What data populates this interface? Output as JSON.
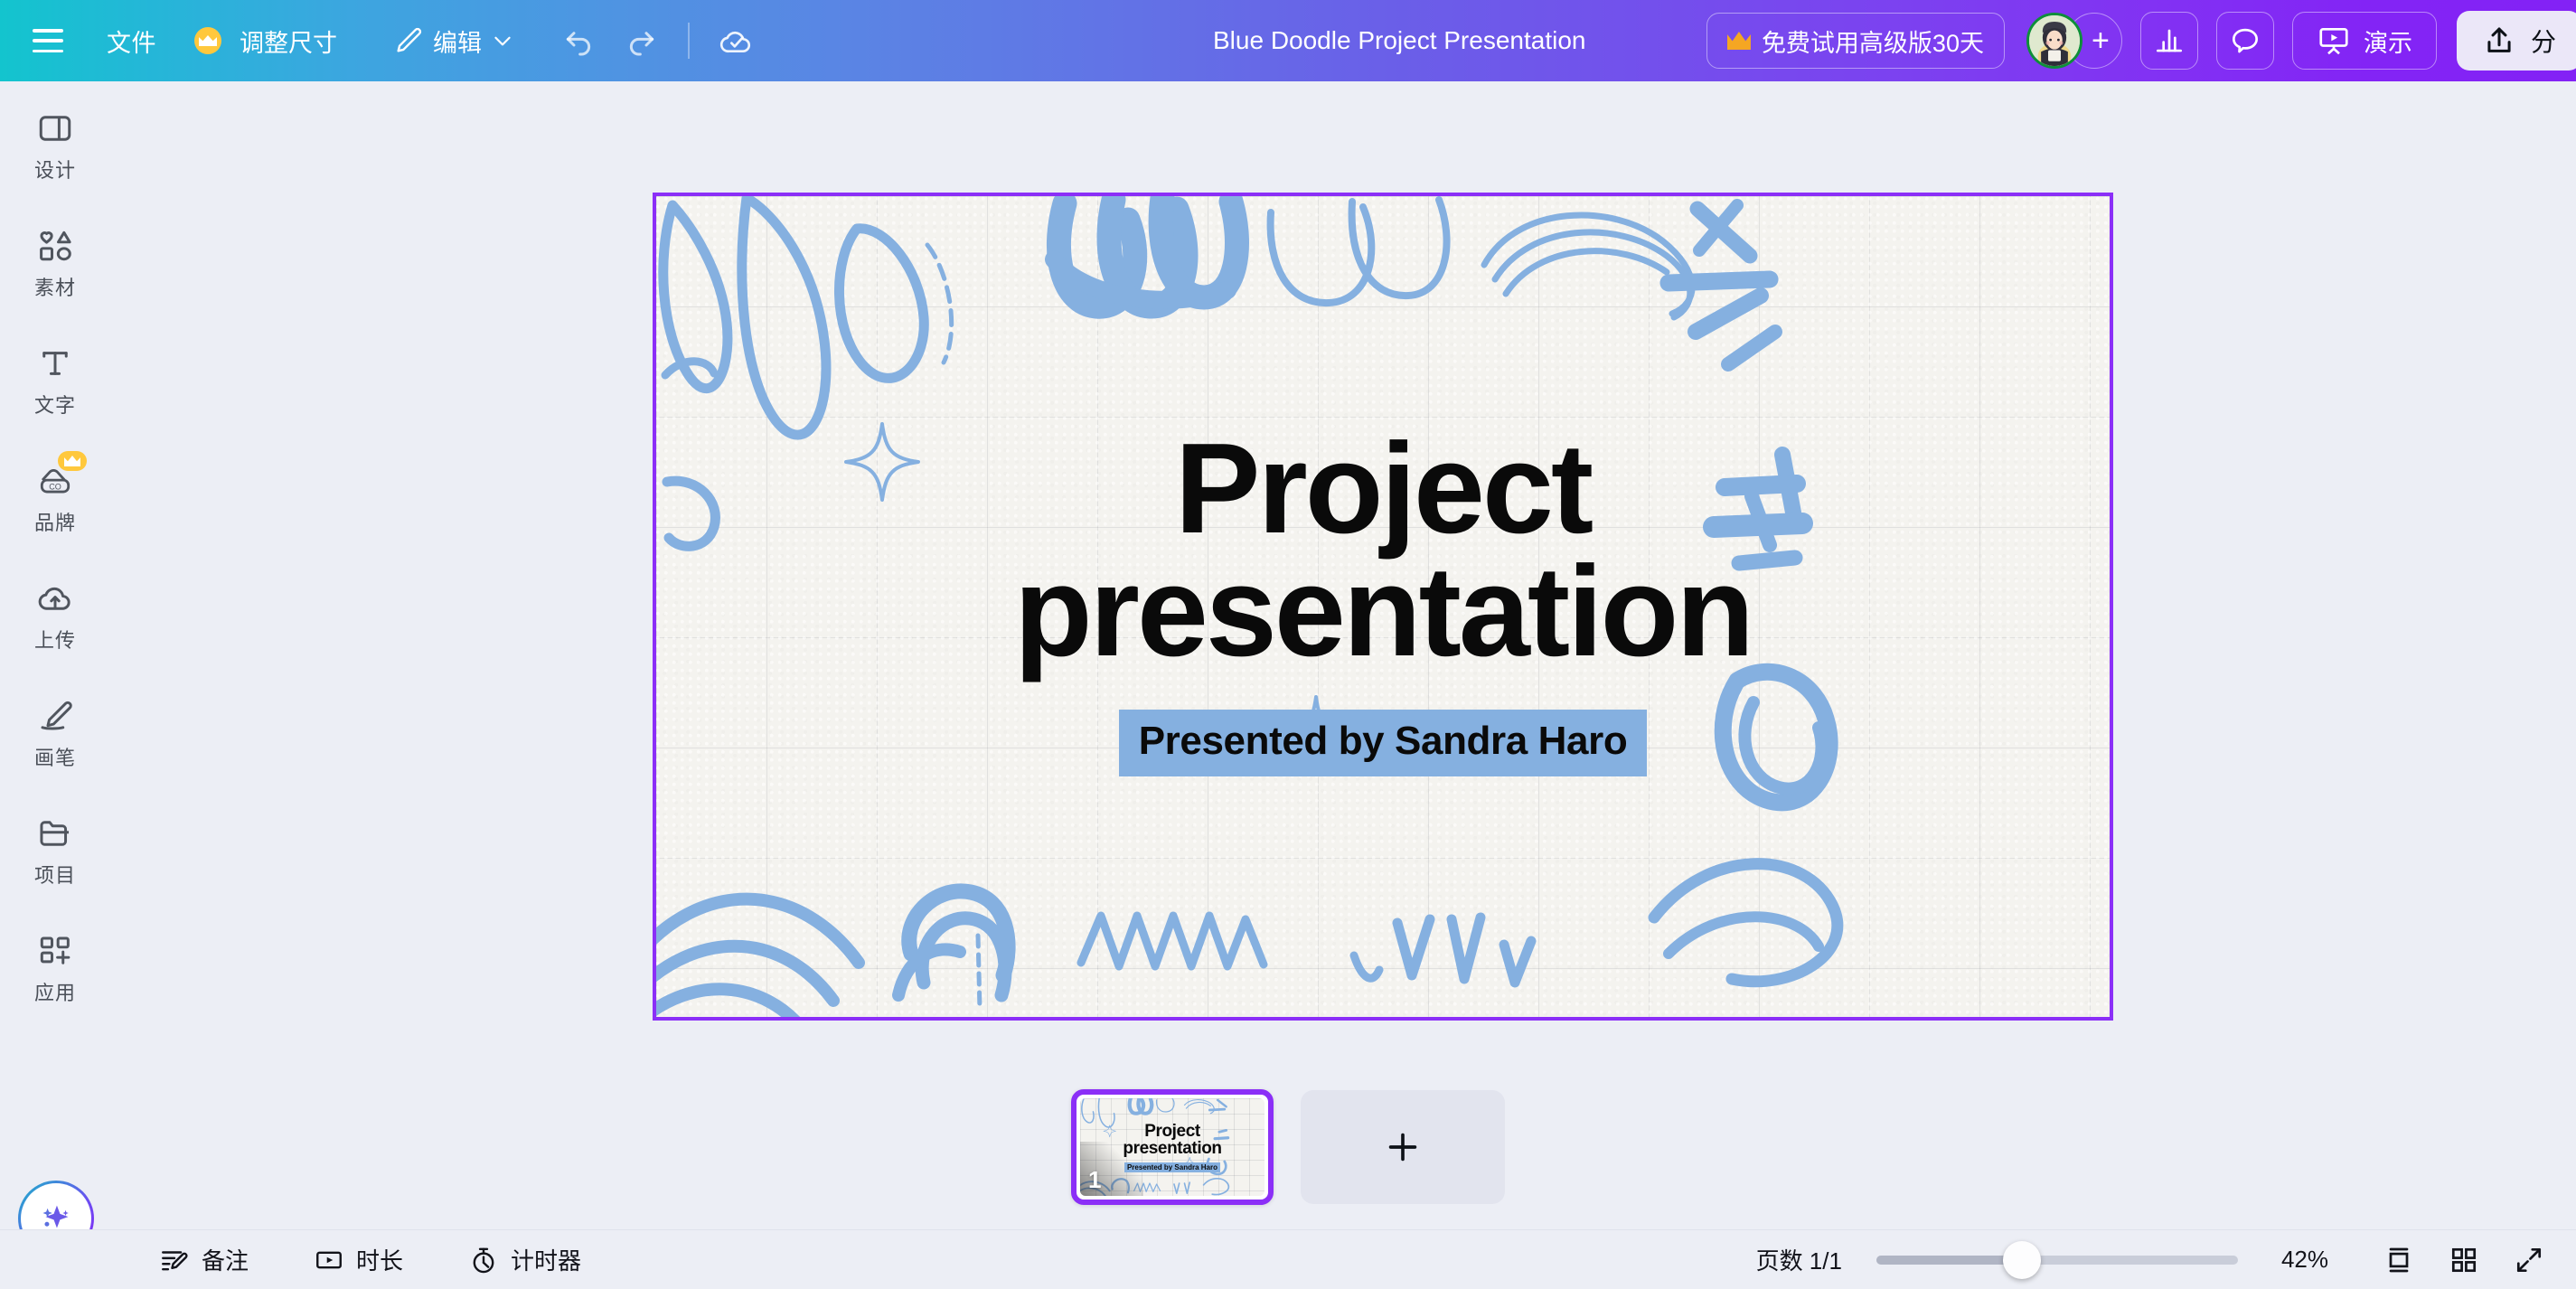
{
  "topbar": {
    "menu_icon": "hamburger-menu-icon",
    "file_label": "文件",
    "resize_label": "调整尺寸",
    "resize_icon": "crown-badge-icon",
    "edit_label": "编辑",
    "edit_icon": "pencil-icon",
    "edit_chevron": "chevron-down-icon",
    "undo_icon": "undo-arrow-icon",
    "redo_icon": "redo-arrow-icon",
    "saved_icon": "cloud-check-icon",
    "doc_title": "Blue Doodle Project Presentation",
    "trial_label": "免费试用高级版30天",
    "trial_icon": "crown-icon",
    "avatar_name": "user-avatar",
    "add_collaborator": "+",
    "insights_icon": "bar-chart-icon",
    "comments_icon": "speech-bubble-icon",
    "present_label": "演示",
    "present_icon": "presentation-play-icon",
    "share_label": "分",
    "share_icon": "share-upload-icon"
  },
  "sidebar": {
    "items": [
      {
        "label": "设计",
        "icon": "layout-panel-icon",
        "badge": false
      },
      {
        "label": "素材",
        "icon": "shapes-elements-icon",
        "badge": false
      },
      {
        "label": "文字",
        "icon": "text-t-icon",
        "badge": false
      },
      {
        "label": "品牌",
        "icon": "brand-kit-icon",
        "badge": true
      },
      {
        "label": "上传",
        "icon": "cloud-upload-icon",
        "badge": false
      },
      {
        "label": "画笔",
        "icon": "draw-pen-icon",
        "badge": false
      },
      {
        "label": "项目",
        "icon": "folder-icon",
        "badge": false
      },
      {
        "label": "应用",
        "icon": "apps-grid-plus-icon",
        "badge": false
      }
    ],
    "ai_button": "magic-sparkle-icon"
  },
  "slide": {
    "headline_line1": "Project",
    "headline_line2": "presentation",
    "subtitle": "Presented by Sandra Haro",
    "accent_color": "#85b0e0",
    "doodle_color": "#85b0e0",
    "selection_color": "#8b2ff7",
    "paper_color": "#f4f3ef"
  },
  "slide_strip": {
    "thumb_title_line1": "Project",
    "thumb_title_line2": "presentation",
    "thumb_subtitle": "Presented by Sandra Haro",
    "thumb_number": "1",
    "add_slide_icon": "plus-icon"
  },
  "bottombar": {
    "notes_label": "备注",
    "notes_icon": "notes-pencil-icon",
    "duration_label": "时长",
    "duration_icon": "play-rect-icon",
    "timer_label": "计时器",
    "timer_icon": "stopwatch-icon",
    "page_count": "页数 1/1",
    "zoom_value": "42%",
    "fit_icon": "fit-page-icon",
    "grid_icon": "grid-view-icon",
    "fullscreen_icon": "expand-arrows-icon"
  }
}
